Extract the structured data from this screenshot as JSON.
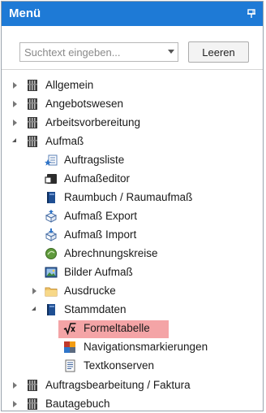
{
  "panel": {
    "title": "Menü",
    "title_bar_color": "#1e7ad6",
    "pin_icon": "pin-icon"
  },
  "search": {
    "placeholder": "Suchtext eingeben...",
    "value": "",
    "clear_label": "Leeren"
  },
  "tree": {
    "highlight_color": "#f4a4a6",
    "items": [
      {
        "label": "Allgemein",
        "icon": "book-icon",
        "expander": "collapsed"
      },
      {
        "label": "Angebotswesen",
        "icon": "book-icon",
        "expander": "collapsed"
      },
      {
        "label": "Arbeitsvorbereitung",
        "icon": "book-icon",
        "expander": "collapsed"
      },
      {
        "label": "Aufmaß",
        "icon": "book-icon",
        "expander": "expanded"
      },
      {
        "label": "Auftragsliste",
        "icon": "list-star-icon"
      },
      {
        "label": "Aufmaßeditor",
        "icon": "editor-icon"
      },
      {
        "label": "Raumbuch / Raumaufmaß",
        "icon": "blue-book-icon"
      },
      {
        "label": "Aufmaß Export",
        "icon": "export-box-icon"
      },
      {
        "label": "Aufmaß Import",
        "icon": "import-box-icon"
      },
      {
        "label": "Abrechnungskreise",
        "icon": "green-circle-icon"
      },
      {
        "label": "Bilder Aufmaß",
        "icon": "picture-icon"
      },
      {
        "label": "Ausdrucke",
        "icon": "folder-icon",
        "expander": "collapsed"
      },
      {
        "label": "Stammdaten",
        "icon": "blue-book-icon",
        "expander": "expanded"
      },
      {
        "label": "Formeltabelle",
        "icon": "formula-sqrt-icon",
        "selected": true
      },
      {
        "label": "Navigationsmarkierungen",
        "icon": "color-squares-icon"
      },
      {
        "label": "Textkonserven",
        "icon": "text-document-icon"
      },
      {
        "label": "Auftragsbearbeitung / Faktura",
        "icon": "book-icon",
        "expander": "collapsed"
      },
      {
        "label": "Bautagebuch",
        "icon": "book-icon",
        "expander": "collapsed"
      }
    ]
  }
}
